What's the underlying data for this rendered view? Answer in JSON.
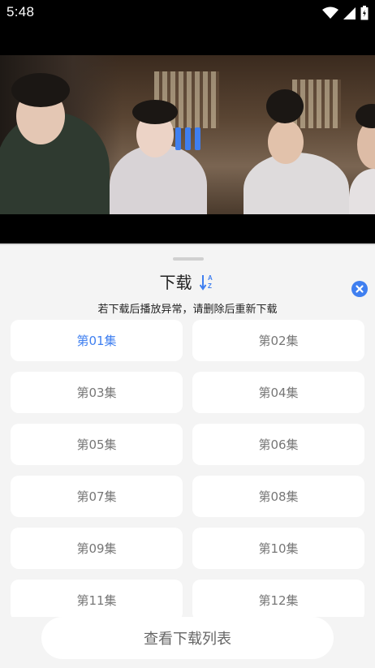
{
  "status_bar": {
    "time": "5:48",
    "icons": [
      "wifi-icon",
      "cellular-signal-icon",
      "battery-icon"
    ]
  },
  "video": {
    "state": "loading"
  },
  "download_sheet": {
    "title": "下载",
    "sort_icon": "sort-az-icon",
    "close_icon": "close-circle-icon",
    "notice": "若下载后播放异常，请删除后重新下载",
    "episodes": [
      {
        "label": "第01集",
        "selected": true
      },
      {
        "label": "第02集",
        "selected": false
      },
      {
        "label": "第03集",
        "selected": false
      },
      {
        "label": "第04集",
        "selected": false
      },
      {
        "label": "第05集",
        "selected": false
      },
      {
        "label": "第06集",
        "selected": false
      },
      {
        "label": "第07集",
        "selected": false
      },
      {
        "label": "第08集",
        "selected": false
      },
      {
        "label": "第09集",
        "selected": false
      },
      {
        "label": "第10集",
        "selected": false
      },
      {
        "label": "第11集",
        "selected": false
      },
      {
        "label": "第12集",
        "selected": false
      }
    ],
    "view_list_label": "查看下载列表"
  },
  "colors": {
    "accent": "#3f7ff0",
    "sheet_bg": "#f4f4f4",
    "card_bg": "#ffffff",
    "episode_text": "#777777"
  }
}
